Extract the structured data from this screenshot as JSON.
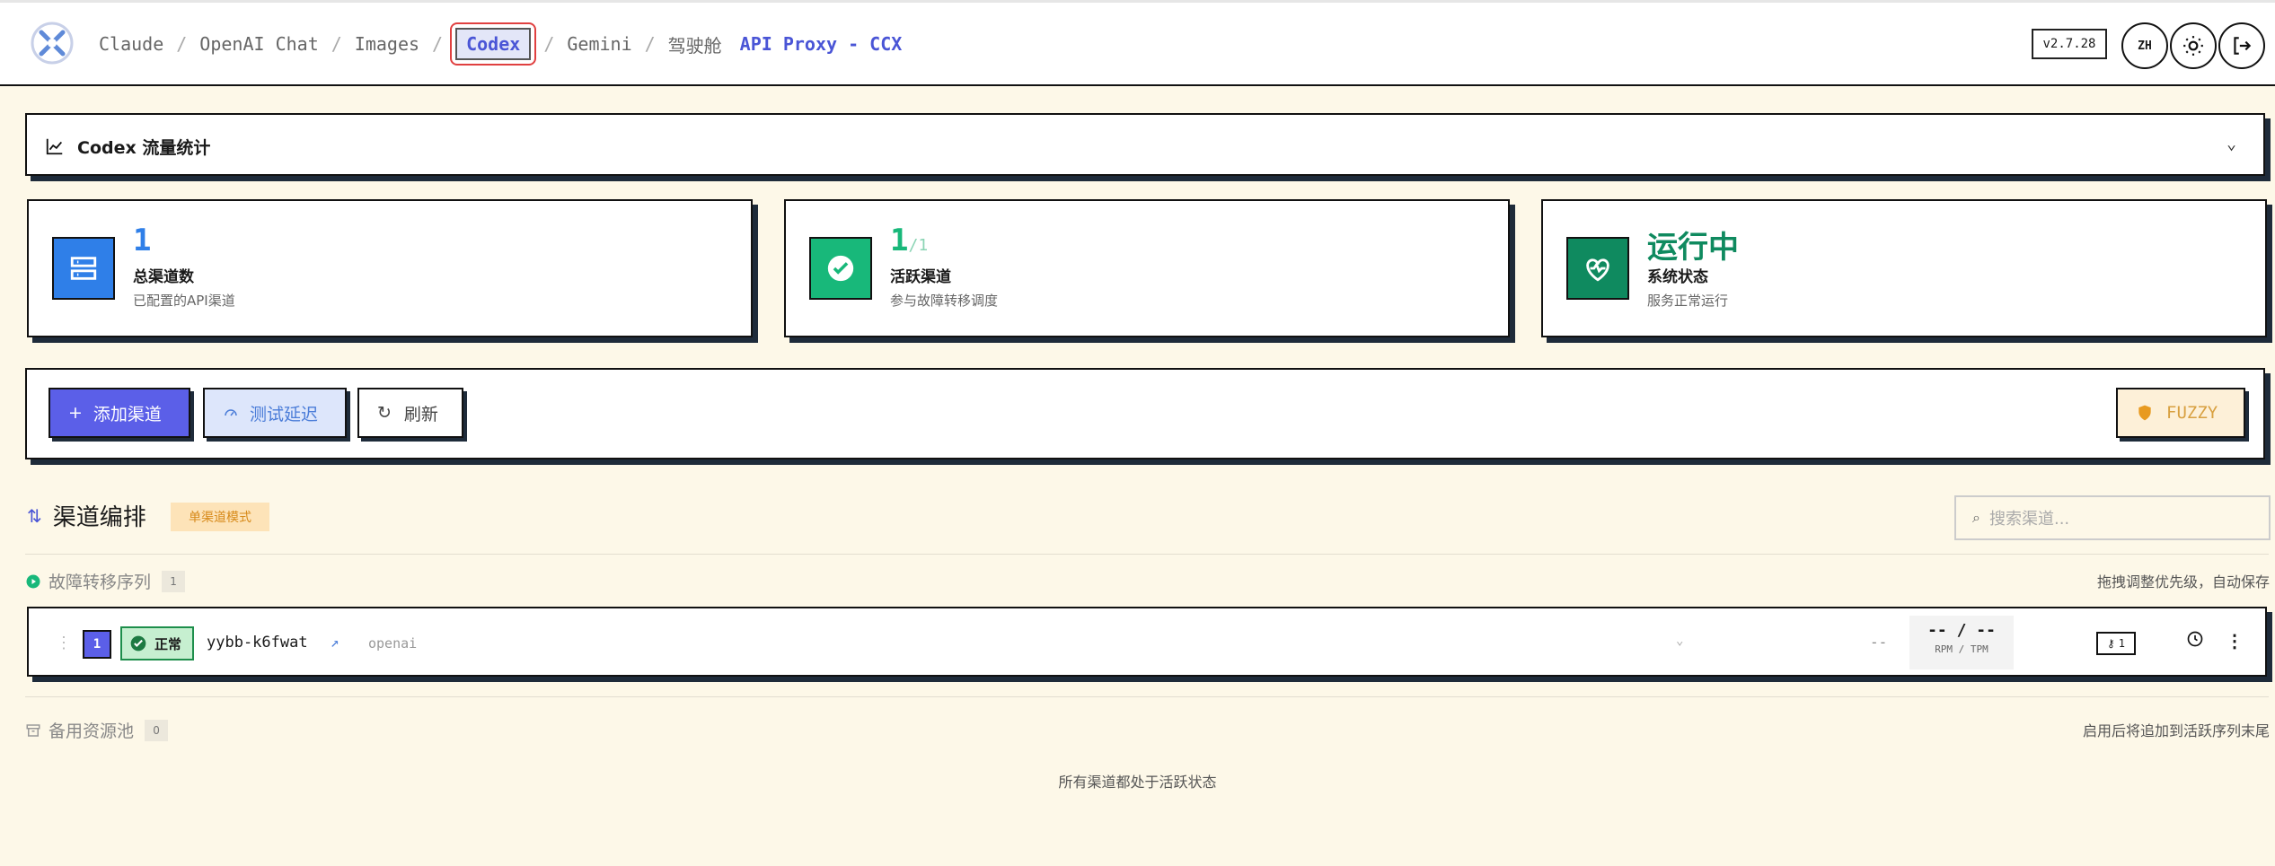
{
  "nav": {
    "items": [
      "Claude",
      "OpenAI Chat",
      "Images",
      "Codex",
      "Gemini",
      "驾驶舱"
    ],
    "active": "Codex",
    "app_title": "API Proxy - CCX"
  },
  "header": {
    "version": "v2.7.28",
    "lang": "ZH"
  },
  "stats_panel": {
    "label": "Codex 流量统计"
  },
  "cards": [
    {
      "value": "1",
      "value_suffix": "",
      "label": "总渠道数",
      "sub": "已配置的API渠道",
      "color": "#2f7fe8"
    },
    {
      "value": "1",
      "value_suffix": "/1",
      "label": "活跃渠道",
      "sub": "参与故障转移调度",
      "color": "#18b87a"
    },
    {
      "value": "运行中",
      "value_suffix": "",
      "label": "系统状态",
      "sub": "服务正常运行",
      "color": "#0f8a5f"
    }
  ],
  "toolbar": {
    "add": "添加渠道",
    "test": "测试延迟",
    "refresh": "刷新",
    "fuzzy": "FUZZY"
  },
  "section": {
    "title": "渠道编排",
    "mode": "单渠道模式",
    "search_placeholder": "搜索渠道..."
  },
  "failover": {
    "title": "故障转移序列",
    "count": "1",
    "hint": "拖拽调整优先级，自动保存",
    "channels": [
      {
        "index": "1",
        "status": "正常",
        "name": "yybb-k6fwat",
        "service": "openai",
        "latency": "--",
        "rate": "-- / --",
        "rate_label": "RPM / TPM",
        "keys": "1"
      }
    ]
  },
  "backup": {
    "title": "备用资源池",
    "count": "0",
    "hint": "启用后将追加到活跃序列末尾",
    "empty": "所有渠道都处于活跃状态"
  }
}
